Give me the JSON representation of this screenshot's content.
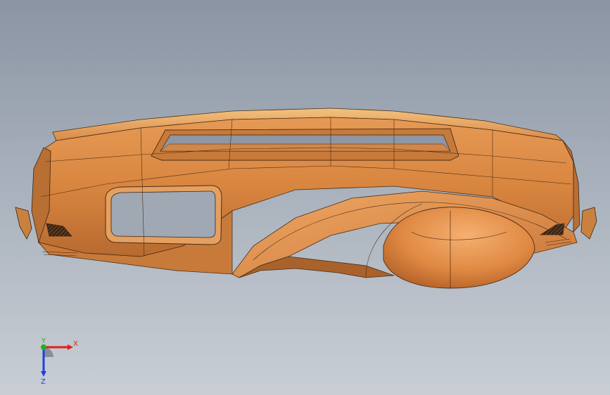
{
  "viewport": {
    "background_top": "#8b95a3",
    "background_bottom": "#c9ced5"
  },
  "model": {
    "part": "instrument-panel",
    "surface_color": "#d9884a",
    "highlight_color": "#f0b070",
    "shadow_color": "#9c5b2a",
    "edge_color": "#2a1a10"
  },
  "triad": {
    "x_label": "X",
    "y_label": "Y",
    "z_label": "Z",
    "x_color": "#e02020",
    "y_color": "#20b020",
    "z_color": "#2040e0"
  }
}
